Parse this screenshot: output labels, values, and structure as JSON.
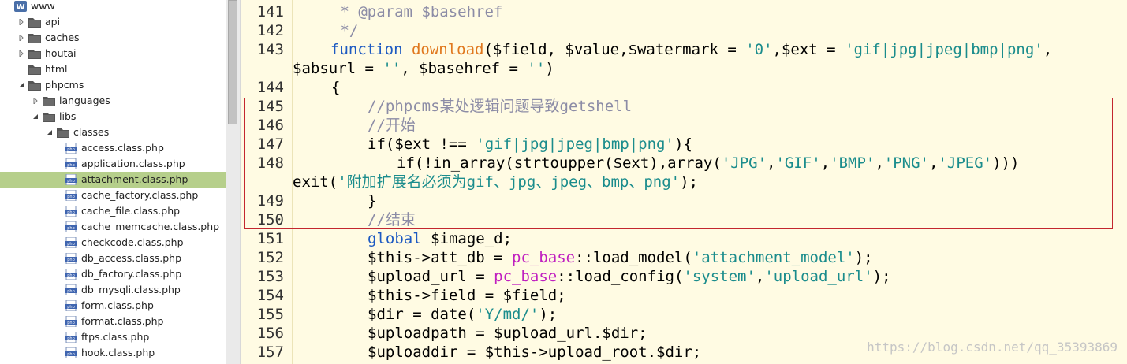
{
  "file_tree": {
    "items": [
      {
        "label": "www",
        "icon": "wamp-logo-icon",
        "twisty": "none"
      },
      {
        "label": "api",
        "icon": "folder-icon",
        "twisty": "collapsed"
      },
      {
        "label": "caches",
        "icon": "folder-icon",
        "twisty": "collapsed"
      },
      {
        "label": "houtai",
        "icon": "folder-icon",
        "twisty": "collapsed"
      },
      {
        "label": "html",
        "icon": "folder-icon",
        "twisty": "none"
      },
      {
        "label": "phpcms",
        "icon": "folder-icon",
        "twisty": "expanded"
      },
      {
        "label": "languages",
        "icon": "folder-icon",
        "twisty": "collapsed"
      },
      {
        "label": "libs",
        "icon": "folder-icon",
        "twisty": "expanded"
      },
      {
        "label": "classes",
        "icon": "folder-icon",
        "twisty": "expanded"
      },
      {
        "label": "access.class.php",
        "icon": "php-file-icon",
        "twisty": "none"
      },
      {
        "label": "application.class.php",
        "icon": "php-file-icon",
        "twisty": "none"
      },
      {
        "label": "attachment.class.php",
        "icon": "php-file-icon",
        "twisty": "none",
        "selected": true
      },
      {
        "label": "cache_factory.class.php",
        "icon": "php-file-icon",
        "twisty": "none"
      },
      {
        "label": "cache_file.class.php",
        "icon": "php-file-icon",
        "twisty": "none"
      },
      {
        "label": "cache_memcache.class.php",
        "icon": "php-file-icon",
        "twisty": "none"
      },
      {
        "label": "checkcode.class.php",
        "icon": "php-file-icon",
        "twisty": "none"
      },
      {
        "label": "db_access.class.php",
        "icon": "php-file-icon",
        "twisty": "none"
      },
      {
        "label": "db_factory.class.php",
        "icon": "php-file-icon",
        "twisty": "none"
      },
      {
        "label": "db_mysqli.class.php",
        "icon": "php-file-icon",
        "twisty": "none"
      },
      {
        "label": "form.class.php",
        "icon": "php-file-icon",
        "twisty": "none"
      },
      {
        "label": "format.class.php",
        "icon": "php-file-icon",
        "twisty": "none"
      },
      {
        "label": "ftps.class.php",
        "icon": "php-file-icon",
        "twisty": "none"
      },
      {
        "label": "hook.class.php",
        "icon": "php-file-icon",
        "twisty": "none"
      }
    ],
    "selected_color": "#b6cf8b"
  },
  "editor": {
    "line_numbers": [
      "141",
      "142",
      "143",
      "144",
      "145",
      "146",
      "147",
      "148",
      "149",
      "150",
      "151",
      "152",
      "153",
      "154",
      "155",
      "156",
      "157"
    ],
    "code": {
      "l141": {
        "a": " * @param $basehref"
      },
      "l142": {
        "a": " */"
      },
      "l143": {
        "a": "function",
        "b": " ",
        "c": "download",
        "d": "($field, $value,$watermark = ",
        "e": "'0'",
        "f": ",$ext = ",
        "g": "'gif|jpg|jpeg|bmp|png'",
        "h": ","
      },
      "l143w": {
        "a": "$absurl = ",
        "b": "''",
        "c": ", $basehref = ",
        "d": "''",
        "e": ")"
      },
      "l144": {
        "a": "{"
      },
      "l145": {
        "a": "//phpcms某处逻辑问题导致getshell"
      },
      "l146": {
        "a": "//开始"
      },
      "l147": {
        "a": "if($ext !== ",
        "b": "'gif|jpg|jpeg|bmp|png'",
        "c": "){"
      },
      "l148": {
        "a": "if(!in_array(strtoupper($ext),array(",
        "b": "'JPG'",
        "c": ",",
        "d": "'GIF'",
        "e": ",",
        "f": "'BMP'",
        "g": ",",
        "h": "'PNG'",
        "i": ",",
        "j": "'JPEG'",
        "k": ")))"
      },
      "l148w": {
        "a": "exit(",
        "b": "'附加扩展名必须为gif、jpg、jpeg、bmp、png'",
        "c": ");"
      },
      "l149": {
        "a": "}"
      },
      "l150": {
        "a": "//结束"
      },
      "l151": {
        "a": "global",
        "b": " $image_d;"
      },
      "l152": {
        "a": "$this->att_db = ",
        "b": "pc_base",
        "c": "::load_model(",
        "d": "'attachment_model'",
        "e": ");"
      },
      "l153": {
        "a": "$upload_url = ",
        "b": "pc_base",
        "c": "::load_config(",
        "d": "'system'",
        "e": ",",
        "f": "'upload_url'",
        "g": ");"
      },
      "l154": {
        "a": "$this->field = $field;"
      },
      "l155": {
        "a": "$dir = date(",
        "b": "'Y/md/'",
        "c": ");"
      },
      "l156": {
        "a": "$uploadpath = $upload_url.$dir;"
      },
      "l157": {
        "a": "$uploaddir = $this->upload_root.$dir;"
      }
    },
    "colors": {
      "background": "#fffbe3",
      "comment": "#8c8ca6",
      "keyword": "#1d5ac2",
      "function_name": "#e0781e",
      "string": "#1a8c8c",
      "class_name": "#c020c0",
      "highlight_border": "#c3262f"
    }
  },
  "watermark": "https://blog.csdn.net/qq_35393869"
}
